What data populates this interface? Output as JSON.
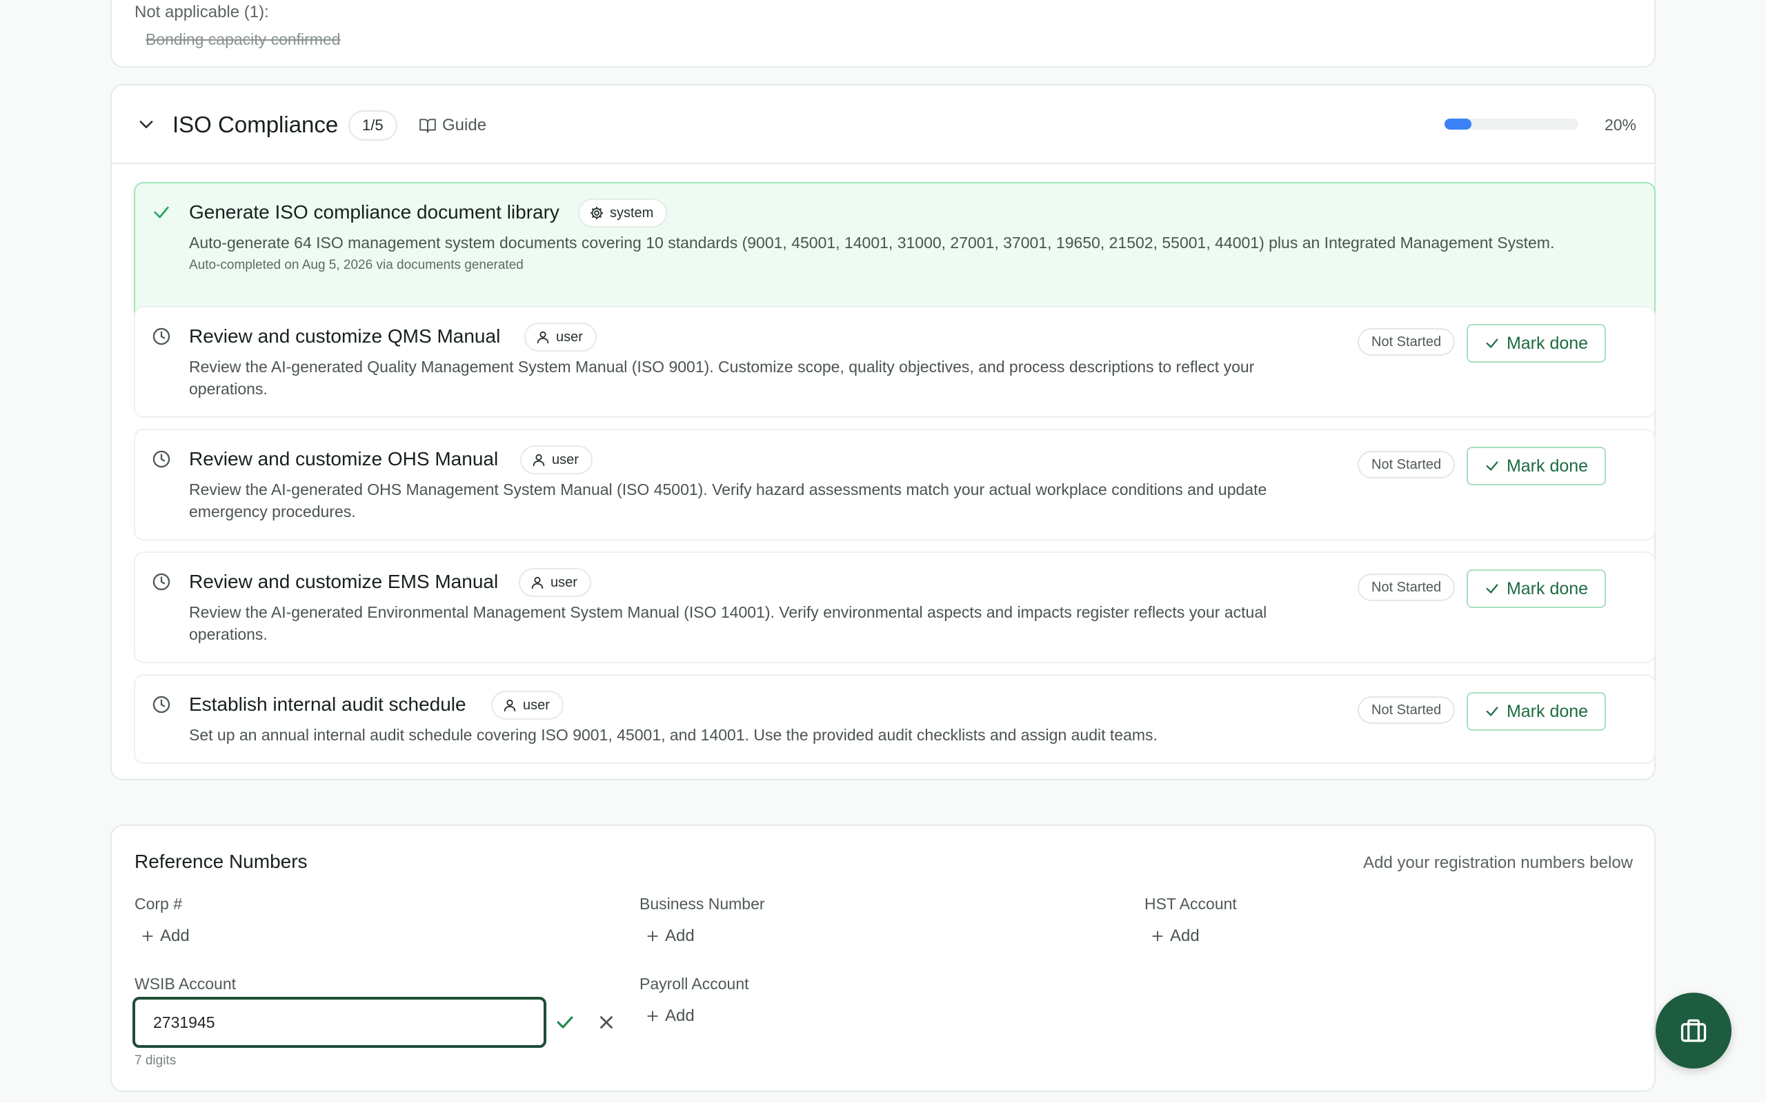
{
  "not_applicable": {
    "title": "Not applicable (1):",
    "items": [
      "Bonding capacity confirmed"
    ]
  },
  "iso_section": {
    "title": "ISO Compliance",
    "count": "1/5",
    "guide_label": "Guide",
    "progress_percent": 20,
    "progress_label": "20%",
    "accent_color": "#3b82f6",
    "tasks": [
      {
        "title": "Generate ISO compliance document library",
        "role": "system",
        "role_icon": "gear-icon",
        "description": "Auto-generate 64 ISO management system documents covering 10 standards (9001, 45001, 14001, 31000, 27001, 37001, 19650, 21502, 55001, 44001) plus an Integrated Management System.",
        "note": "Auto-completed on Aug 5, 2026 via documents generated",
        "status": "done",
        "status_icon": "check-icon"
      },
      {
        "title": "Review and customize QMS Manual",
        "role": "user",
        "role_icon": "user-icon",
        "description": "Review the AI-generated Quality Management System Manual (ISO 9001). Customize scope, quality objectives, and process descriptions to reflect your operations.",
        "status": "Not Started",
        "status_icon": "clock-icon",
        "action_label": "Mark done"
      },
      {
        "title": "Review and customize OHS Manual",
        "role": "user",
        "role_icon": "user-icon",
        "description": "Review the AI-generated OHS Management System Manual (ISO 45001). Verify hazard assessments match your actual workplace conditions and update emergency procedures.",
        "status": "Not Started",
        "status_icon": "clock-icon",
        "action_label": "Mark done"
      },
      {
        "title": "Review and customize EMS Manual",
        "role": "user",
        "role_icon": "user-icon",
        "description": "Review the AI-generated Environmental Management System Manual (ISO 14001). Verify environmental aspects and impacts register reflects your actual operations.",
        "status": "Not Started",
        "status_icon": "clock-icon",
        "action_label": "Mark done"
      },
      {
        "title": "Establish internal audit schedule",
        "role": "user",
        "role_icon": "user-icon",
        "description": "Set up an annual internal audit schedule covering ISO 9001, 45001, and 14001. Use the provided audit checklists and assign audit teams.",
        "status": "Not Started",
        "status_icon": "clock-icon",
        "action_label": "Mark done"
      }
    ]
  },
  "reference_numbers": {
    "title": "Reference Numbers",
    "hint": "Add your registration numbers below",
    "add_label": "Add",
    "fields": [
      {
        "label": "Corp #"
      },
      {
        "label": "Business Number"
      },
      {
        "label": "HST Account"
      },
      {
        "label": "WSIB Account",
        "value": "2731945",
        "helper": "7 digits"
      },
      {
        "label": "Payroll Account"
      }
    ]
  },
  "fab": {
    "icon": "briefcase-icon",
    "color": "#1d5c3f"
  }
}
